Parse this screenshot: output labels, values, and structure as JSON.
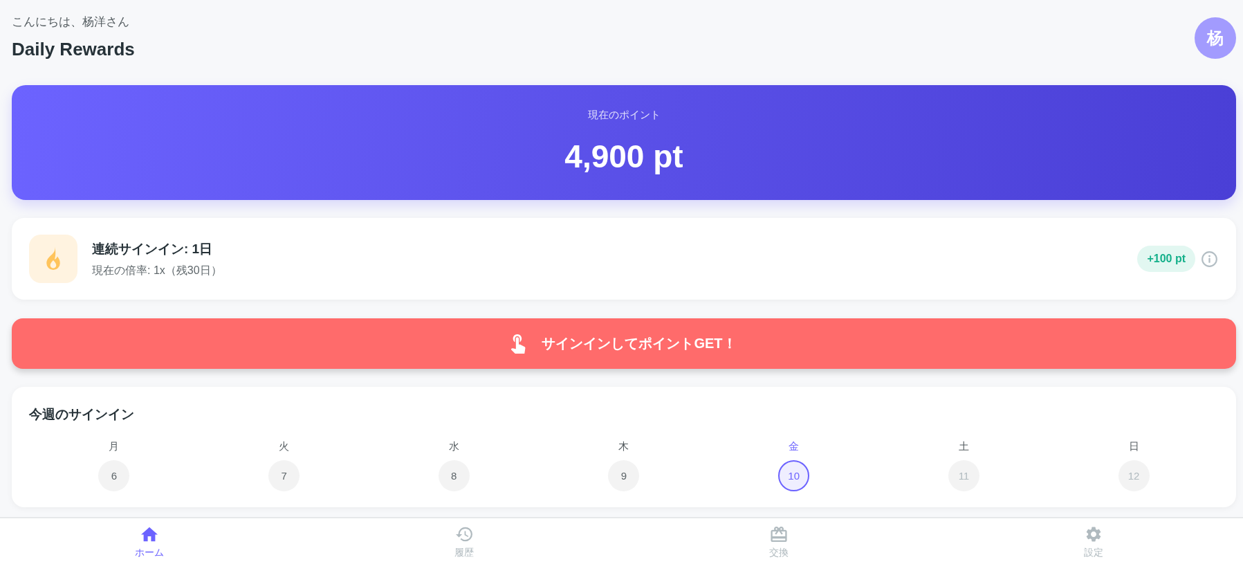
{
  "header": {
    "greeting": "こんにちは、杨洋さん",
    "title": "Daily Rewards",
    "avatar": {
      "initial": "杨"
    }
  },
  "points_card": {
    "label": "現在のポイント",
    "value": "4,900 pt"
  },
  "streak_card": {
    "title": "連続サインイン: 1日",
    "subtitle": "現在の倍率: 1x（残30日）",
    "badge": "+100 pt"
  },
  "sign_in_button": {
    "label": "サインインしてポイントGET！"
  },
  "week_card": {
    "title": "今週のサインイン",
    "days": [
      {
        "weekday": "月",
        "date": "6",
        "selected": false,
        "disabled": false
      },
      {
        "weekday": "火",
        "date": "7",
        "selected": false,
        "disabled": false
      },
      {
        "weekday": "水",
        "date": "8",
        "selected": false,
        "disabled": false
      },
      {
        "weekday": "木",
        "date": "9",
        "selected": false,
        "disabled": false
      },
      {
        "weekday": "金",
        "date": "10",
        "selected": true,
        "disabled": false
      },
      {
        "weekday": "土",
        "date": "11",
        "selected": false,
        "disabled": true
      },
      {
        "weekday": "日",
        "date": "12",
        "selected": false,
        "disabled": true
      }
    ]
  },
  "bottom_nav": {
    "items": [
      {
        "kind": "home",
        "label": "ホーム",
        "selected": true
      },
      {
        "kind": "history",
        "label": "履歴",
        "selected": false
      },
      {
        "kind": "gift",
        "label": "交換",
        "selected": false
      },
      {
        "kind": "settings",
        "label": "設定",
        "selected": false
      }
    ]
  }
}
